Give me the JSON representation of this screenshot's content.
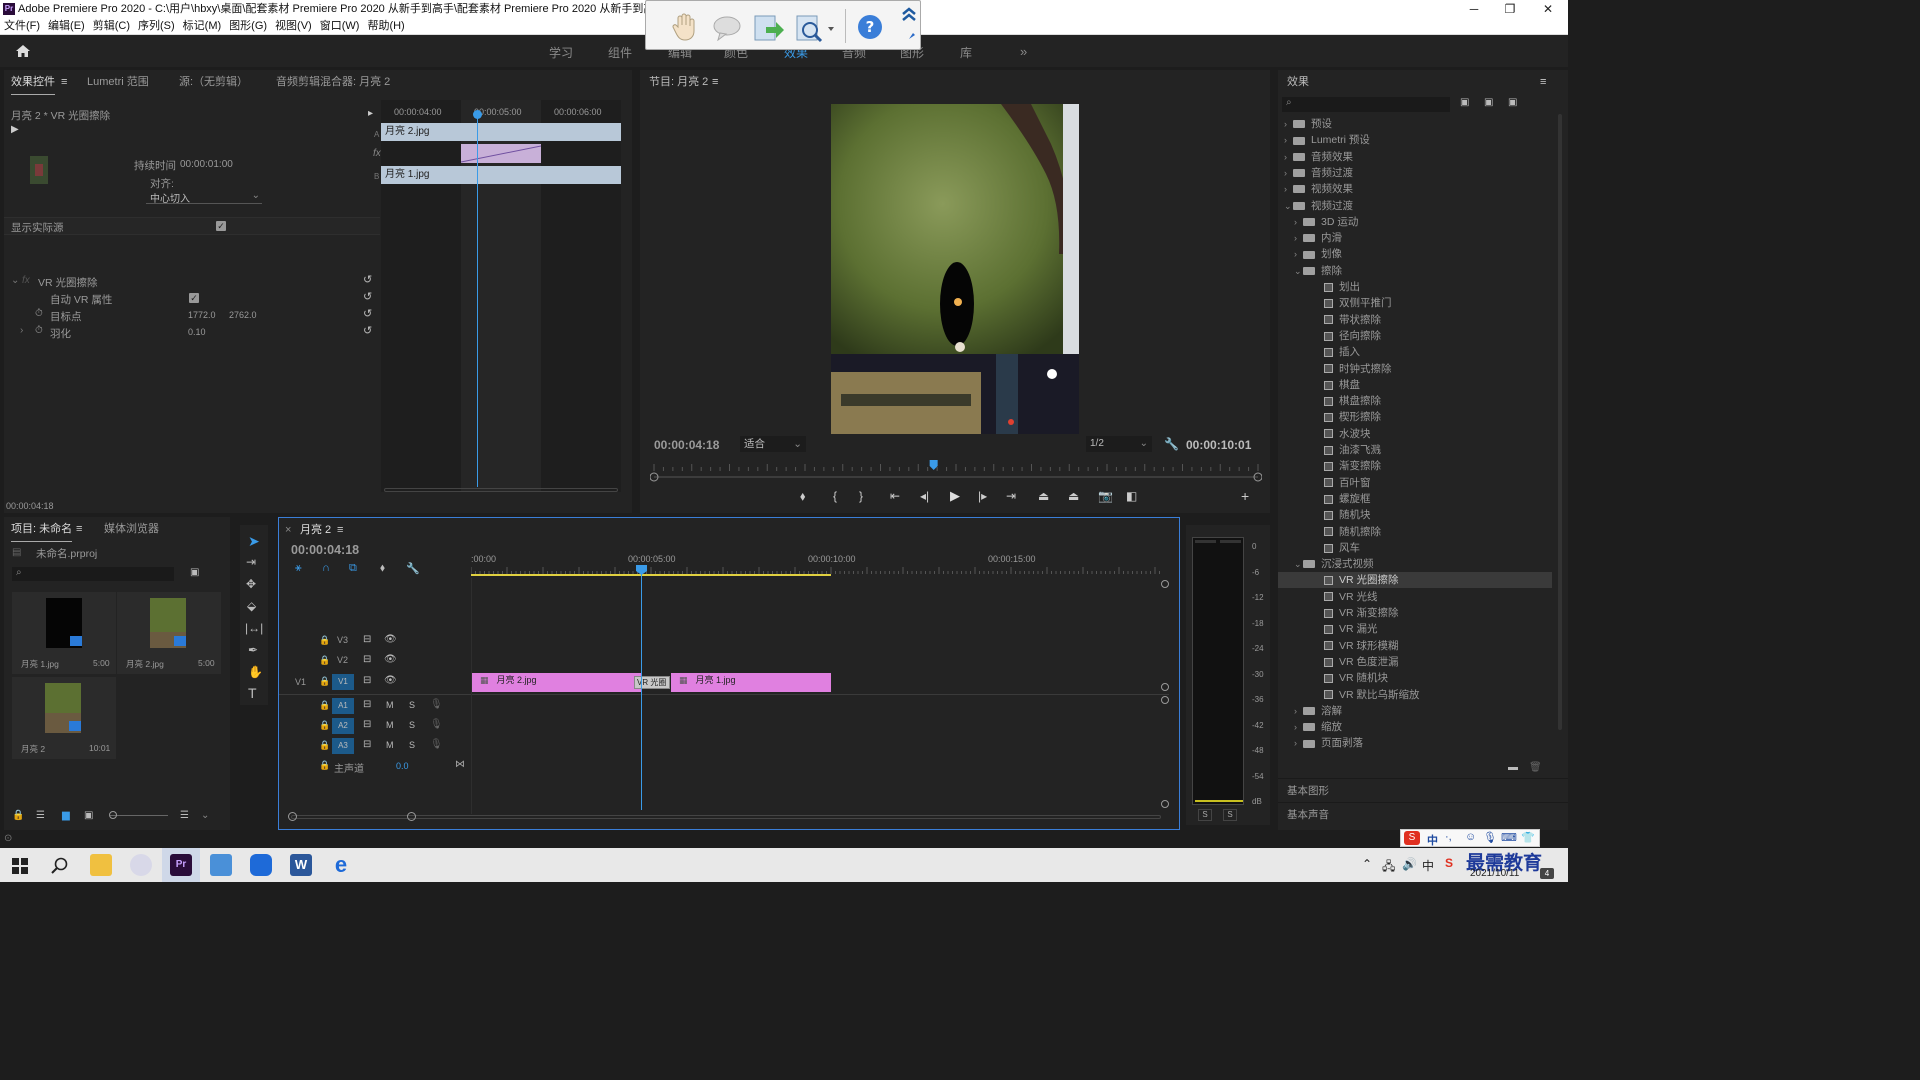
{
  "app": {
    "title": "Adobe Premiere Pro 2020 - C:\\用户\\hbxy\\桌面\\配套素材 Premiere Pro 2020 从新手到高手\\配套素材 Premiere Pro 2020 从新手到高手\\第",
    "logo": "Pr"
  },
  "menu": [
    "文件(F)",
    "编辑(E)",
    "剪辑(C)",
    "序列(S)",
    "标记(M)",
    "图形(G)",
    "视图(V)",
    "窗口(W)",
    "帮助(H)"
  ],
  "workspaces": [
    "学习",
    "组件",
    "编辑",
    "颜色",
    "效果",
    "音频",
    "图形",
    "库"
  ],
  "effect_controls": {
    "tabs": [
      "效果控件",
      "Lumetri 范围",
      "源:（无剪辑）",
      "音频剪辑混合器: 月亮 2"
    ],
    "clip_path": "月亮 2 * VR 光圈擦除",
    "ruler": [
      "00:00:04:00",
      "00:00:05:00",
      "00:00:06:00"
    ],
    "duration_label": "持续时间",
    "duration_value": "00:00:01:00",
    "align_label": "对齐:",
    "align_value": "中心切入",
    "show_source": "显示实际源",
    "label_a": "A",
    "label_b": "B",
    "clip_a": "月亮 2.jpg",
    "clip_b": "月亮 1.jpg",
    "effect_name": "VR 光圈擦除",
    "auto_vr": "自动 VR 属性",
    "target_label": "目标点",
    "target_x": "1772.0",
    "target_y": "2762.0",
    "feather_label": "羽化",
    "feather_value": "0.10",
    "timecode": "00:00:04:18"
  },
  "program": {
    "title": "节目: 月亮 2",
    "timecode": "00:00:04:18",
    "fit": "适合",
    "resolution": "1/2",
    "duration": "00:00:10:01",
    "playhead_fraction": 0.463
  },
  "effects_panel": {
    "title": "效果",
    "items": [
      {
        "label": "预设",
        "level": 0,
        "type": "folder",
        "expanded": false
      },
      {
        "label": "Lumetri 预设",
        "level": 0,
        "type": "folder",
        "expanded": false
      },
      {
        "label": "音频效果",
        "level": 0,
        "type": "folder",
        "expanded": false
      },
      {
        "label": "音频过渡",
        "level": 0,
        "type": "folder",
        "expanded": false
      },
      {
        "label": "视频效果",
        "level": 0,
        "type": "folder",
        "expanded": false
      },
      {
        "label": "视频过渡",
        "level": 0,
        "type": "folder",
        "expanded": true
      },
      {
        "label": "3D 运动",
        "level": 1,
        "type": "folder",
        "expanded": false
      },
      {
        "label": "内滑",
        "level": 1,
        "type": "folder",
        "expanded": false
      },
      {
        "label": "划像",
        "level": 1,
        "type": "folder",
        "expanded": false
      },
      {
        "label": "擦除",
        "level": 1,
        "type": "folder",
        "expanded": true
      },
      {
        "label": "划出",
        "level": 2,
        "type": "fx"
      },
      {
        "label": "双侧平推门",
        "level": 2,
        "type": "fx"
      },
      {
        "label": "带状擦除",
        "level": 2,
        "type": "fx"
      },
      {
        "label": "径向擦除",
        "level": 2,
        "type": "fx"
      },
      {
        "label": "插入",
        "level": 2,
        "type": "fx"
      },
      {
        "label": "时钟式擦除",
        "level": 2,
        "type": "fx"
      },
      {
        "label": "棋盘",
        "level": 2,
        "type": "fx"
      },
      {
        "label": "棋盘擦除",
        "level": 2,
        "type": "fx"
      },
      {
        "label": "楔形擦除",
        "level": 2,
        "type": "fx"
      },
      {
        "label": "水波块",
        "level": 2,
        "type": "fx"
      },
      {
        "label": "油漆飞溅",
        "level": 2,
        "type": "fx"
      },
      {
        "label": "渐变擦除",
        "level": 2,
        "type": "fx"
      },
      {
        "label": "百叶窗",
        "level": 2,
        "type": "fx"
      },
      {
        "label": "螺旋框",
        "level": 2,
        "type": "fx"
      },
      {
        "label": "随机块",
        "level": 2,
        "type": "fx"
      },
      {
        "label": "随机擦除",
        "level": 2,
        "type": "fx"
      },
      {
        "label": "风车",
        "level": 2,
        "type": "fx"
      },
      {
        "label": "沉浸式视频",
        "level": 1,
        "type": "folder",
        "expanded": true
      },
      {
        "label": "VR 光圈擦除",
        "level": 2,
        "type": "fx",
        "selected": true
      },
      {
        "label": "VR 光线",
        "level": 2,
        "type": "fx"
      },
      {
        "label": "VR 渐变擦除",
        "level": 2,
        "type": "fx"
      },
      {
        "label": "VR 漏光",
        "level": 2,
        "type": "fx"
      },
      {
        "label": "VR 球形模糊",
        "level": 2,
        "type": "fx"
      },
      {
        "label": "VR 色度泄漏",
        "level": 2,
        "type": "fx"
      },
      {
        "label": "VR 随机块",
        "level": 2,
        "type": "fx"
      },
      {
        "label": "VR 默比乌斯缩放",
        "level": 2,
        "type": "fx"
      },
      {
        "label": "溶解",
        "level": 1,
        "type": "folder",
        "expanded": false
      },
      {
        "label": "缩放",
        "level": 1,
        "type": "folder",
        "expanded": false
      },
      {
        "label": "页面剥落",
        "level": 1,
        "type": "folder",
        "expanded": false
      }
    ],
    "basic_graphics": "基本图形",
    "basic_sound": "基本声音"
  },
  "project": {
    "tabs": [
      "项目: 未命名",
      "媒体浏览器"
    ],
    "file": "未命名.prproj",
    "items": [
      {
        "name": "月亮 1.jpg",
        "duration": "5:00"
      },
      {
        "name": "月亮 2.jpg",
        "duration": "5:00"
      },
      {
        "name": "月亮 2",
        "duration": "10:01"
      }
    ]
  },
  "timeline": {
    "tab": "月亮 2",
    "timecode": "00:00:04:18",
    "ruler": [
      ":00:00",
      "00:00:05:00",
      "00:00:10:00",
      "00:00:15:00"
    ],
    "video_tracks": [
      "V3",
      "V2",
      "V1"
    ],
    "audio_tracks": [
      "A1",
      "A2",
      "A3"
    ],
    "source_patch": "V1",
    "master_label": "主声道",
    "master_value": "0.0",
    "clip1": "月亮 2.jpg",
    "clip2": "月亮 1.jpg",
    "transition": "VR 光圈",
    "mute": "M",
    "solo": "S"
  },
  "meter": {
    "scale": [
      "0",
      "-6",
      "-12",
      "-18",
      "-24",
      "-30",
      "-36",
      "-42",
      "-48",
      "-54",
      "dB"
    ],
    "solo": [
      "S",
      "S"
    ]
  },
  "taskbar": {
    "date": "2021/10/11",
    "watermark": "最需教育"
  }
}
